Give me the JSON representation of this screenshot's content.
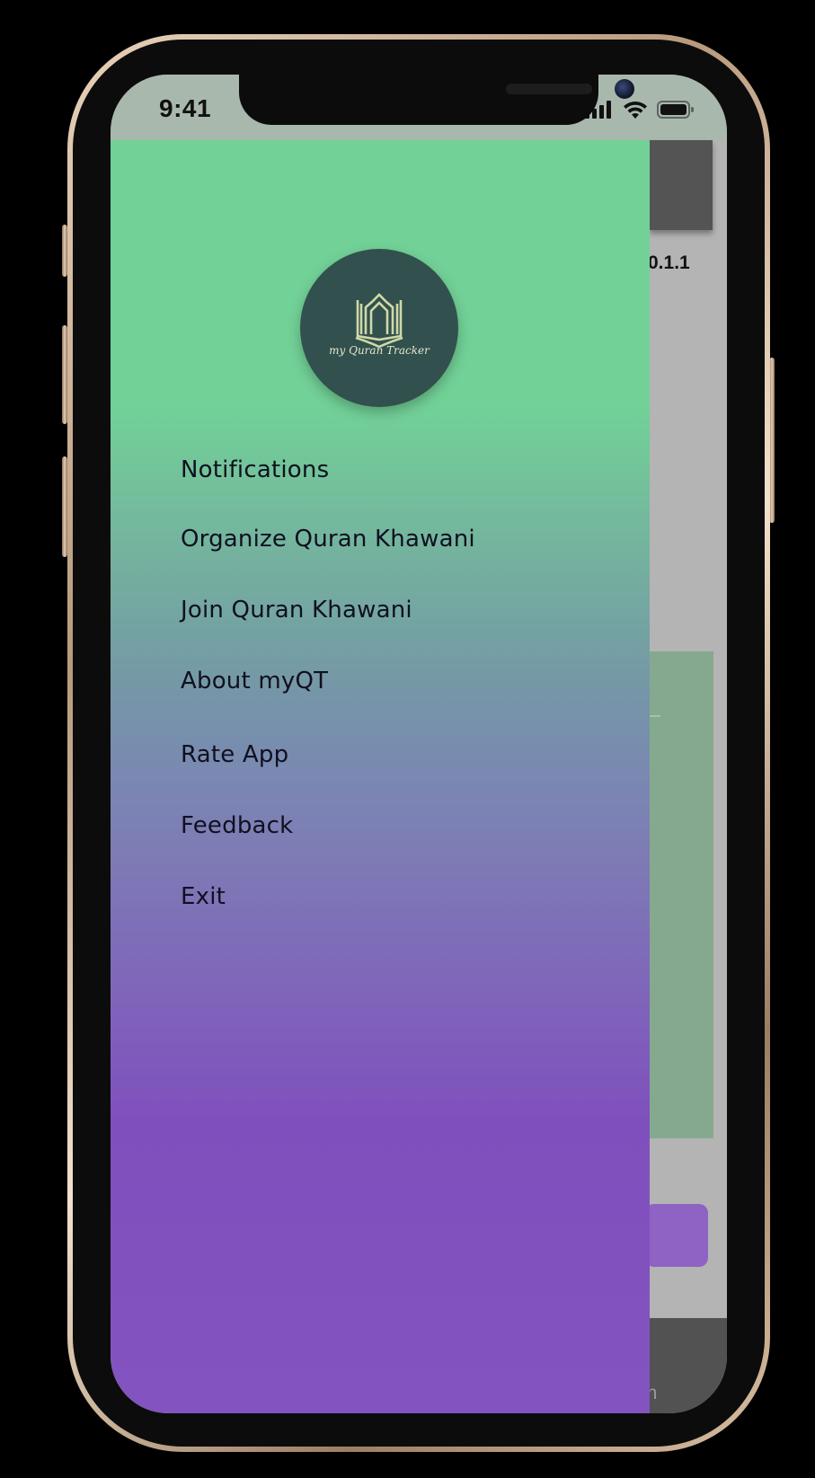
{
  "status_bar": {
    "time": "9:41",
    "icons": [
      "cellular-signal-icon",
      "wifi-icon",
      "battery-icon"
    ]
  },
  "background_screen": {
    "version_text": "0.1.1",
    "bottom_tab_label": "on"
  },
  "drawer": {
    "logo": {
      "icon": "quran-tracker-logo-icon",
      "text": "my Quran Tracker"
    },
    "menu_items": [
      {
        "label": "Notifications"
      },
      {
        "label": "Organize Quran Khawani"
      },
      {
        "label": "Join Quran Khawani"
      },
      {
        "label": "About myQT"
      },
      {
        "label": "Rate App"
      },
      {
        "label": "Feedback"
      },
      {
        "label": "Exit"
      }
    ]
  },
  "colors": {
    "drawer_gradient_top": "#72d197",
    "drawer_gradient_bottom": "#8354bf",
    "logo_background": "#32504d",
    "logo_mark": "#cfd9a8"
  }
}
